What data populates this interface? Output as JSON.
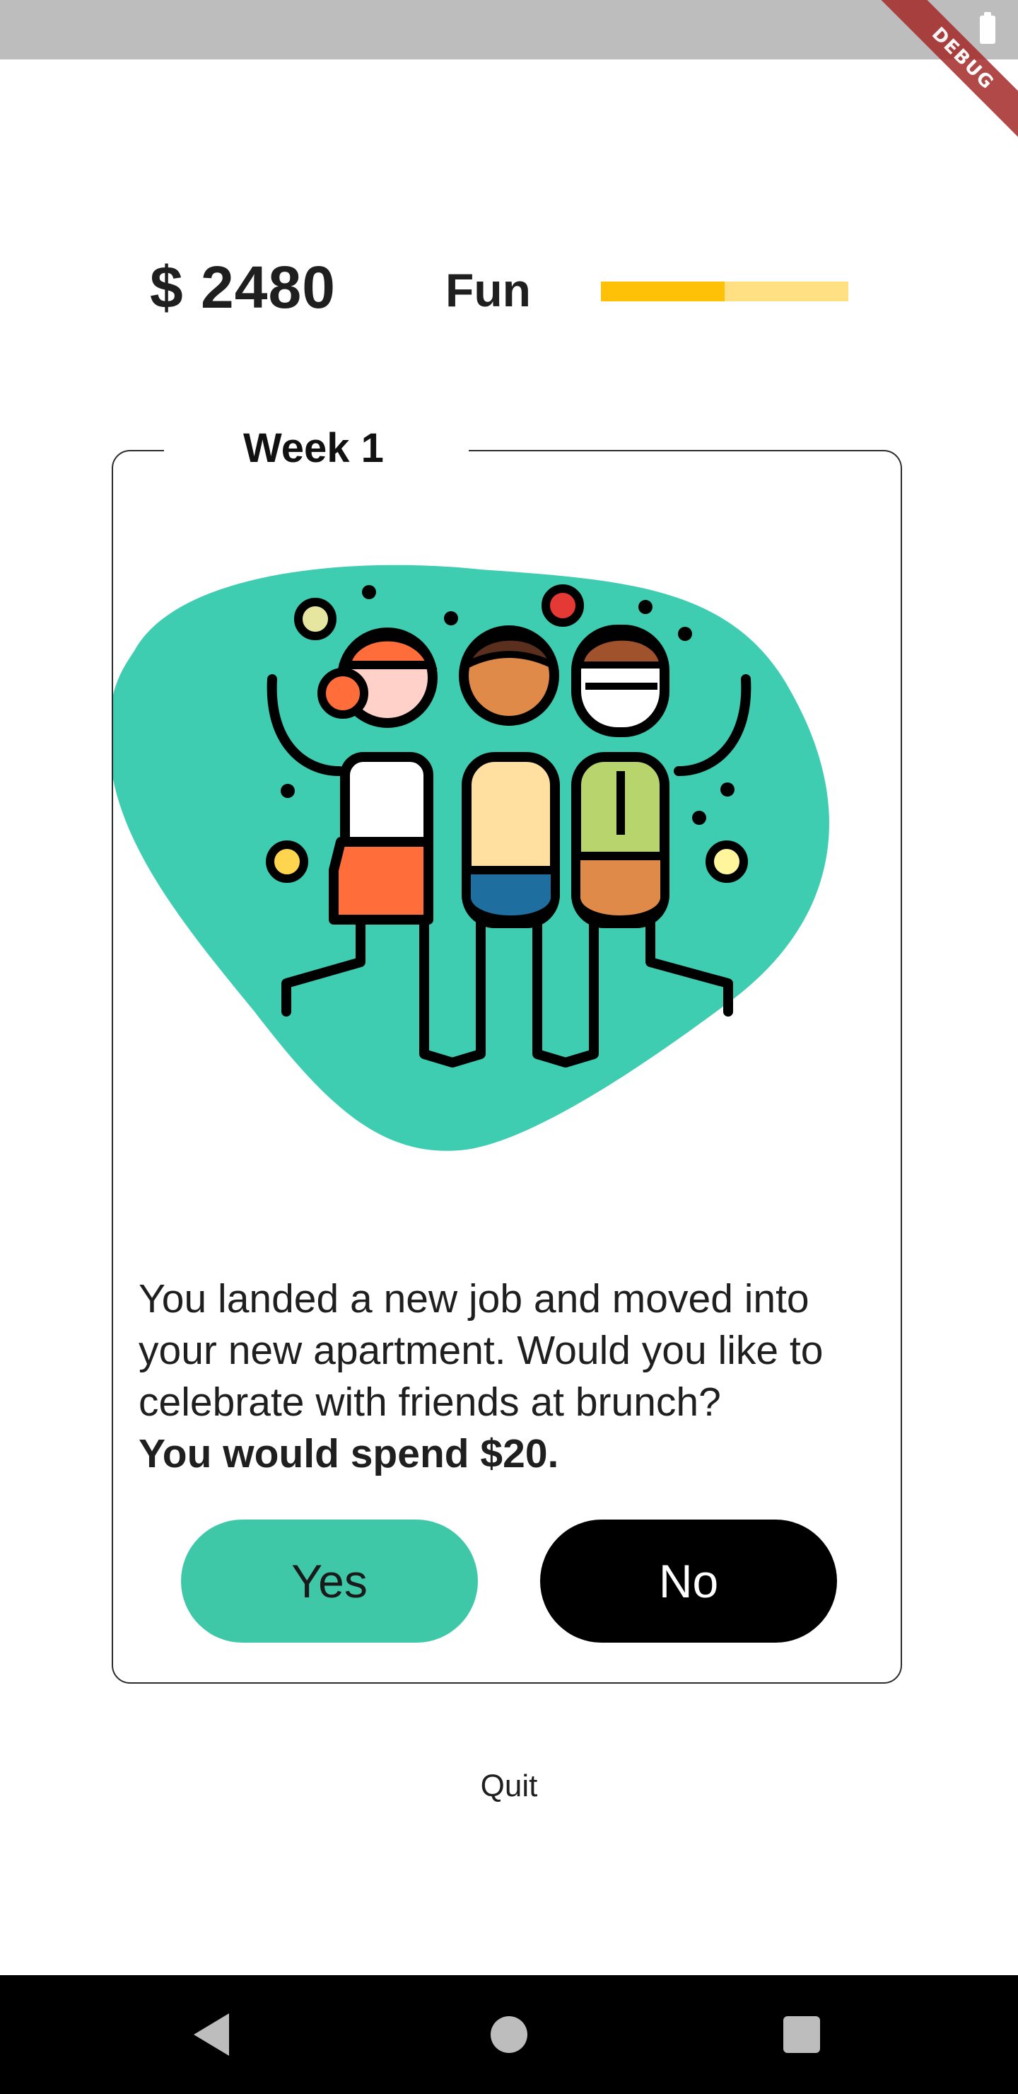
{
  "status_bar": {
    "debug_banner": "DEBUG",
    "battery_icon": "battery-icon"
  },
  "header": {
    "money": "$ 2480",
    "fun_label": "Fun",
    "fun_level_percent": 50,
    "fun_fill_color": "#ffc107",
    "fun_track_color": "#ffe082"
  },
  "card": {
    "week_label": "Week 1",
    "illustration": "friends-celebrating-illustration",
    "illustration_bg_color": "#3ecdb0",
    "prompt_text": "You landed a new job and moved into your new apartment. Would you like to celebrate with friends at brunch?",
    "prompt_cost": "You would spend $20.",
    "yes_label": "Yes",
    "no_label": "No",
    "yes_color": "#3ec8a8",
    "no_color": "#000000"
  },
  "footer": {
    "quit_label": "Quit"
  },
  "nav": {
    "back_icon": "back-triangle-icon",
    "home_icon": "home-circle-icon",
    "recents_icon": "recents-square-icon"
  }
}
